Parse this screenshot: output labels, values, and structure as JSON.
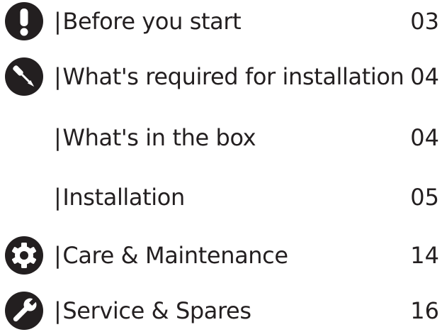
{
  "toc": {
    "rows": [
      {
        "label": "Before you start",
        "page": "03",
        "icon": "exclamation-icon"
      },
      {
        "label": "What's required for installation",
        "page": "04",
        "icon": "screwdriver-icon"
      },
      {
        "label": "What's in the box",
        "page": "04",
        "icon": ""
      },
      {
        "label": "Installation",
        "page": "05",
        "icon": ""
      },
      {
        "label": "Care & Maintenance",
        "page": "14",
        "icon": "gear-icon"
      },
      {
        "label": "Service & Spares",
        "page": "16",
        "icon": "wrench-icon"
      }
    ],
    "separator": "|"
  },
  "colors": {
    "text": "#231f20",
    "icon": "#231f20"
  }
}
